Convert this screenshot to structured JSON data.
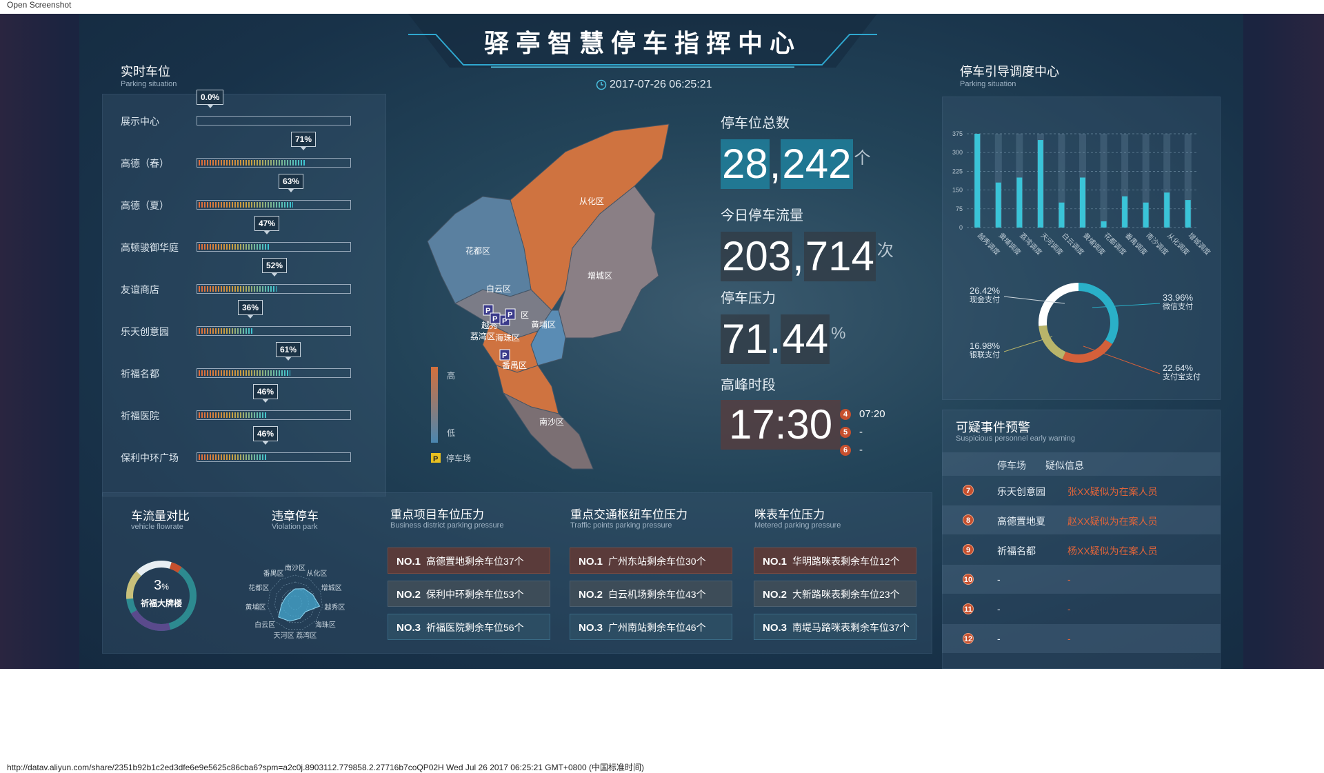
{
  "window": {
    "title": "Open Screenshot",
    "url_line": "http://datav.aliyun.com/share/2351b92b1c2ed3dfe6e9e5625c86cba6?spm=a2c0j.8903112.779858.2.27716b7coQP02H Wed Jul 26 2017 06:25:21 GMT+0800 (中国标准时间)"
  },
  "header": {
    "title": "驿亭智慧停车指挥中心",
    "datetime": "2017-07-26 06:25:21"
  },
  "realtime": {
    "title": "实时车位",
    "subtitle": "Parking situation",
    "items": [
      {
        "name": "展示中心",
        "pct": "0.0%",
        "value": 0.0
      },
      {
        "name": "高德（春）",
        "pct": "71%",
        "value": 71
      },
      {
        "name": "高德（夏）",
        "pct": "63%",
        "value": 63
      },
      {
        "name": "高顿骏御华庭",
        "pct": "47%",
        "value": 47
      },
      {
        "name": "友谊商店",
        "pct": "52%",
        "value": 52
      },
      {
        "name": "乐天创意园",
        "pct": "36%",
        "value": 36
      },
      {
        "name": "祈福名都",
        "pct": "61%",
        "value": 61
      },
      {
        "name": "祈福医院",
        "pct": "46%",
        "value": 46
      },
      {
        "name": "保利中环广场",
        "pct": "46%",
        "value": 46
      }
    ]
  },
  "map": {
    "districts": [
      "从化区",
      "花都区",
      "增城区",
      "白云区",
      "越秀",
      "荔湾区",
      "海珠区",
      "黄埔区",
      "番禺区",
      "南沙区",
      "区"
    ],
    "legend_high": "高",
    "legend_low": "低",
    "legend_parking": "停车场",
    "parking_marker": "P"
  },
  "stats": {
    "total_label": "停车位总数",
    "total_a": "28",
    "total_b": "242",
    "total_sep": ",",
    "total_unit": "个",
    "flow_label": "今日停车流量",
    "flow_a": "203",
    "flow_b": "714",
    "flow_sep": ",",
    "flow_unit": "次",
    "pressure_label": "停车压力",
    "pressure_a": "71",
    "pressure_b": "44",
    "pressure_sep": ".",
    "pressure_unit": "%",
    "peak_label": "高峰时段",
    "peak_time": "17:30",
    "peak_list": [
      {
        "rank": "4",
        "value": "07:20"
      },
      {
        "rank": "5",
        "value": "-"
      },
      {
        "rank": "6",
        "value": "-"
      }
    ]
  },
  "guide": {
    "title": "停车引导调度中心",
    "subtitle": "Parking situation"
  },
  "chart_data": [
    {
      "type": "bar",
      "title": "",
      "yticks": [
        "375",
        "300",
        "225",
        "150",
        "75",
        "0"
      ],
      "ylim": [
        0,
        375
      ],
      "categories": [
        "越秀调度",
        "黄埔调度",
        "荔湾调度",
        "天河调度",
        "白云调度",
        "黄埔调度",
        "花都调度",
        "番禺调度",
        "南沙调度",
        "从化调度",
        "增城调度"
      ],
      "values": [
        375,
        180,
        200,
        350,
        100,
        200,
        25,
        125,
        100,
        140,
        110
      ]
    },
    {
      "type": "pie",
      "title": "",
      "slices": [
        {
          "label": "现金支付",
          "value": 26.42,
          "pct": "26.42%",
          "color": "#ffffff"
        },
        {
          "label": "微信支付",
          "value": 33.96,
          "pct": "33.96%",
          "color": "#2ab0c8"
        },
        {
          "label": "支付宝支付",
          "value": 22.64,
          "pct": "22.64%",
          "color": "#d4603a"
        },
        {
          "label": "银联支付",
          "value": 16.98,
          "pct": "16.98%",
          "color": "#b9b56a"
        }
      ]
    }
  ],
  "warning": {
    "title": "可疑事件预警",
    "subtitle": "Suspicious personnel early warning",
    "col1": "停车场",
    "col2": "疑似信息",
    "rows": [
      {
        "rank": "7",
        "place": "乐天创意园",
        "info": "张XX疑似为在案人员"
      },
      {
        "rank": "8",
        "place": "高德置地夏",
        "info": "赵XX疑似为在案人员"
      },
      {
        "rank": "9",
        "place": "祈福名都",
        "info": "杨XX疑似为在案人员"
      },
      {
        "rank": "10",
        "place": "-",
        "info": "-"
      },
      {
        "rank": "11",
        "place": "-",
        "info": "-"
      },
      {
        "rank": "12",
        "place": "-",
        "info": "-"
      }
    ]
  },
  "flow": {
    "title": "车流量对比",
    "subtitle": "vehicle flowrate",
    "pct": "3",
    "pct_unit": "%",
    "name": "祈福大牌楼"
  },
  "violation": {
    "title": "违章停车",
    "subtitle": "Violation park",
    "labels": [
      "南沙区",
      "从化区",
      "增城区",
      "越秀区",
      "海珠区",
      "荔湾区",
      "天河区",
      "白云区",
      "黄埔区",
      "花都区",
      "番禺区"
    ]
  },
  "business": {
    "title": "重点项目车位压力",
    "subtitle": "Business district parking pressure",
    "items": [
      {
        "no": "NO.1",
        "text": "高德置地剩余车位37个"
      },
      {
        "no": "NO.2",
        "text": "保利中环剩余车位53个"
      },
      {
        "no": "NO.3",
        "text": "祈福医院剩余车位56个"
      }
    ]
  },
  "traffic": {
    "title": "重点交通枢纽车位压力",
    "subtitle": "Traffic points parking pressure",
    "items": [
      {
        "no": "NO.1",
        "text": "广州东站剩余车位30个"
      },
      {
        "no": "NO.2",
        "text": "白云机场剩余车位43个"
      },
      {
        "no": "NO.3",
        "text": "广州南站剩余车位46个"
      }
    ]
  },
  "metered": {
    "title": "咪表车位压力",
    "subtitle": "Metered parking pressure",
    "items": [
      {
        "no": "NO.1",
        "text": "华明路咪表剩余车位12个"
      },
      {
        "no": "NO.2",
        "text": "大新路咪表剩余车位23个"
      },
      {
        "no": "NO.3",
        "text": "南堤马路咪表剩余车位37个"
      }
    ]
  }
}
